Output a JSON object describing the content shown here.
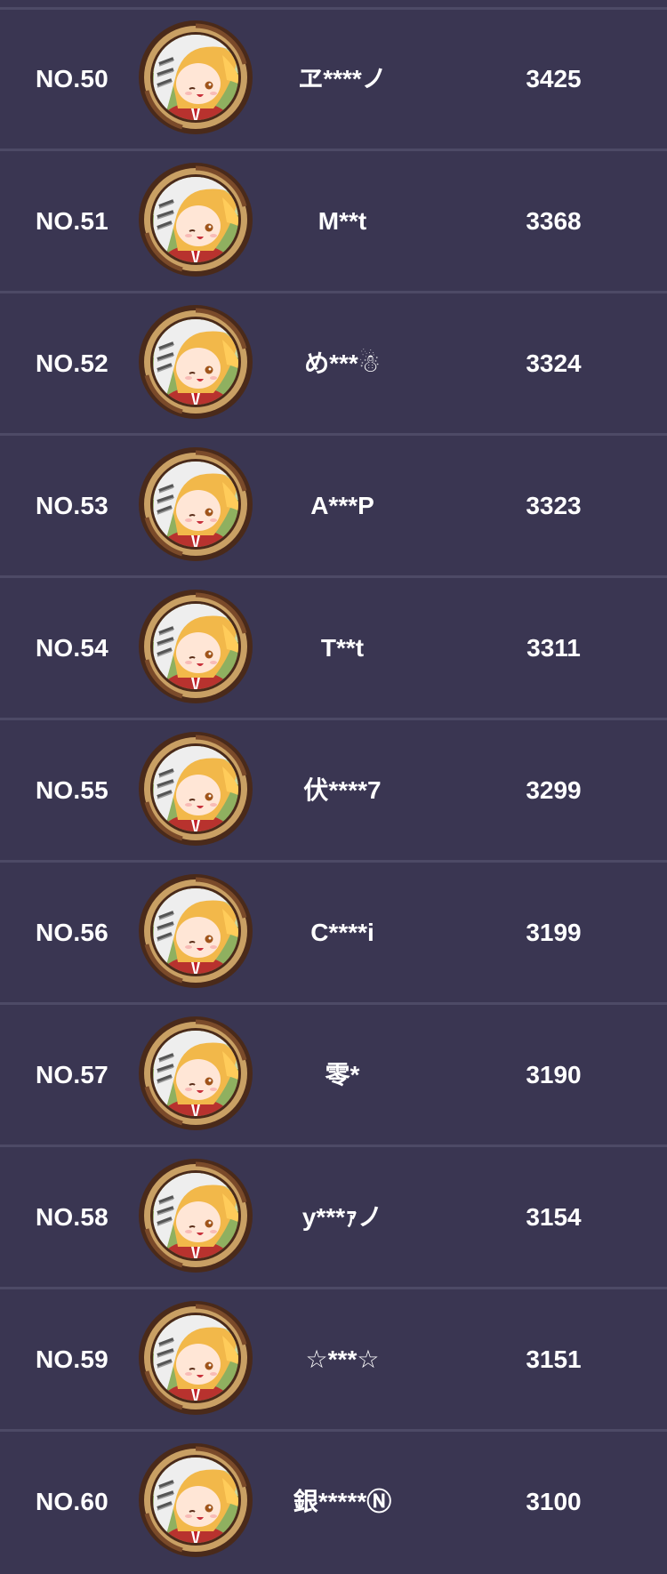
{
  "leaderboard": {
    "rows": [
      {
        "rank": "NO.50",
        "name": "ヱ****ノ",
        "score": "3425"
      },
      {
        "rank": "NO.51",
        "name": "M**t",
        "score": "3368"
      },
      {
        "rank": "NO.52",
        "name": "め***☃",
        "score": "3324"
      },
      {
        "rank": "NO.53",
        "name": "A***P",
        "score": "3323"
      },
      {
        "rank": "NO.54",
        "name": "T**t",
        "score": "3311"
      },
      {
        "rank": "NO.55",
        "name": "伏****7",
        "score": "3299"
      },
      {
        "rank": "NO.56",
        "name": "C****i",
        "score": "3199"
      },
      {
        "rank": "NO.57",
        "name": "零*",
        "score": "3190"
      },
      {
        "rank": "NO.58",
        "name": "y***ｧノ",
        "score": "3154"
      },
      {
        "rank": "NO.59",
        "name": "☆***☆",
        "score": "3151"
      },
      {
        "rank": "NO.60",
        "name": "銀*****Ⓝ",
        "score": "3100"
      }
    ],
    "avatar_icon": "anime-character-avatar-icon"
  },
  "colors": {
    "background": "#3a3652",
    "divider": "#4d4a66",
    "text": "#ffffff",
    "avatar_ring_outer": "#4a2a1a",
    "avatar_ring_inner": "#c9a064",
    "hair": "#f2b84a",
    "hood": "#eeeeee"
  }
}
